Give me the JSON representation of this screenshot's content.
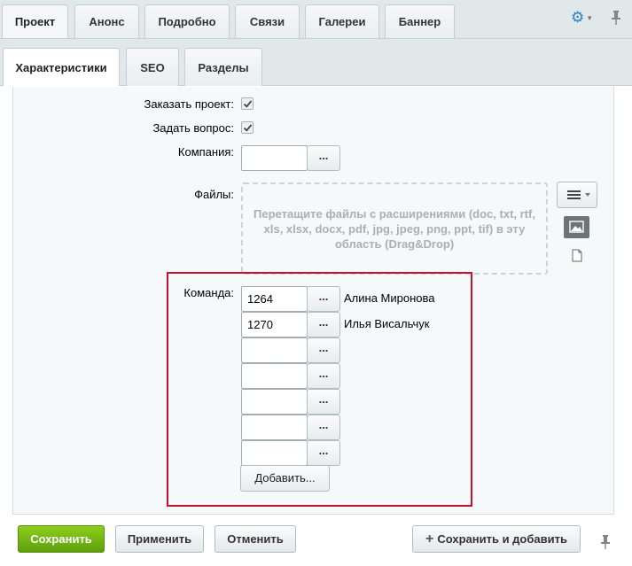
{
  "tabs_row1": [
    "Проект",
    "Анонс",
    "Подробно",
    "Связи",
    "Галереи",
    "Баннер"
  ],
  "tabs_row2": [
    "Характеристики",
    "SEO",
    "Разделы"
  ],
  "form": {
    "order_project_label": "Заказать проект:",
    "ask_question_label": "Задать вопрос:",
    "company_label": "Компания:",
    "company_value": "",
    "files_label": "Файлы:",
    "dropzone_text": "Перетащите файлы с расширениями (doc, txt, rtf, xls, xlsx, docx, pdf, jpg, jpeg, png, ppt, tif) в эту область (Drag&Drop)",
    "team_label": "Команда:",
    "dots_label": "...",
    "team": [
      {
        "id": "1264",
        "name": "Алина Миронова"
      },
      {
        "id": "1270",
        "name": "Илья Висальчук"
      },
      {
        "id": "",
        "name": ""
      },
      {
        "id": "",
        "name": ""
      },
      {
        "id": "",
        "name": ""
      },
      {
        "id": "",
        "name": ""
      },
      {
        "id": "",
        "name": ""
      }
    ],
    "add_label": "Добавить..."
  },
  "footer": {
    "save": "Сохранить",
    "apply": "Применить",
    "cancel": "Отменить",
    "save_and_add": "Сохранить и добавить"
  },
  "colors": {
    "accent_green": "#6cb012",
    "highlight_red": "#c8102e",
    "gear_blue": "#2f7fc1"
  },
  "icons": [
    "gear-icon",
    "pin-icon",
    "checkbox-checked-icon",
    "menu-lines-icon",
    "image-icon",
    "file-icon",
    "plus-icon"
  ]
}
